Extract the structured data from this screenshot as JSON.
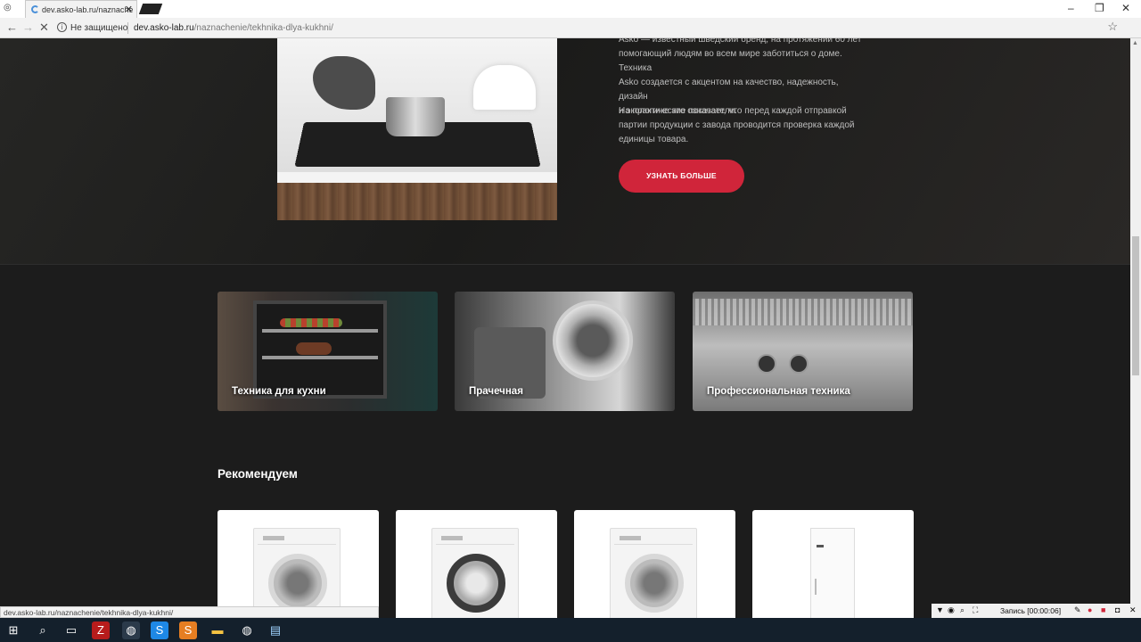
{
  "browser": {
    "tab_title": "dev.asko-lab.ru/naznache",
    "tab_close": "✕",
    "security_label": "Не защищено",
    "url_host": "dev.asko-lab.ru",
    "url_path": "/naznachenie/tekhnika-dlya-kukhni/",
    "status_url": "dev.asko-lab.ru/naznachenie/tekhnika-dlya-kukhni/"
  },
  "hero": {
    "paragraph_1_line_0": "Asko — известный шведский бренд, на протяжении 60 лет",
    "paragraph_1_line_1": "помогающий людям во всем мире заботиться о доме. Техника",
    "paragraph_1_line_2": "Asko создается с акцентом на качество, надежность, дизайн",
    "paragraph_1_line_3": "и экологические показатели.",
    "paragraph_2_line_0": "На практике это означает, что перед каждой отправкой",
    "paragraph_2_line_1": "партии продукции с завода проводится проверка каждой",
    "paragraph_2_line_2": "единицы товара.",
    "cta_label": "УЗНАТЬ БОЛЬШЕ"
  },
  "categories": [
    {
      "label": "Техника для кухни"
    },
    {
      "label": "Прачечная"
    },
    {
      "label": "Профессиональная техника"
    }
  ],
  "recommend": {
    "title": "Рекомендуем"
  },
  "recorder": {
    "label": "Запись [00:00:06]"
  },
  "colors": {
    "accent": "#d0253a",
    "page_background": "#1c1c1c",
    "taskbar": "#14202c"
  }
}
